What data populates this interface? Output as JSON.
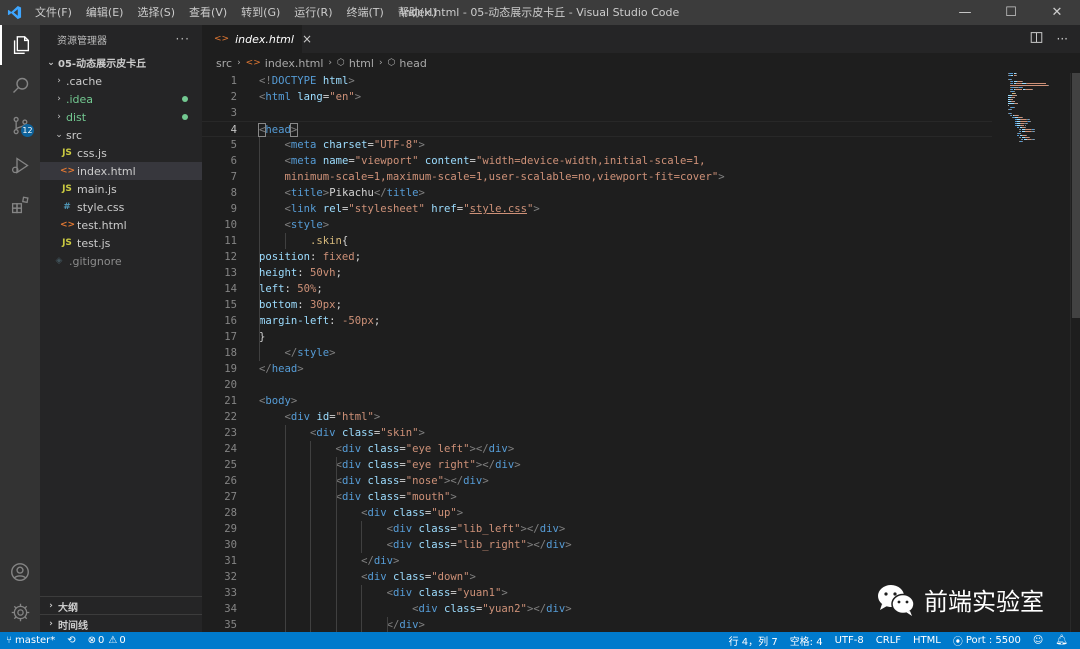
{
  "titlebar": {
    "menus": [
      "文件(F)",
      "编辑(E)",
      "选择(S)",
      "查看(V)",
      "转到(G)",
      "运行(R)",
      "终端(T)",
      "帮助(H)"
    ],
    "title": "index.html - 05-动态展示皮卡丘 - Visual Studio Code",
    "minimize": "—",
    "maximize": "☐",
    "close": "✕"
  },
  "activity": {
    "scm_badge": "12"
  },
  "explorer": {
    "header": "资源管理器",
    "more": "···",
    "root": "05-动态展示皮卡丘",
    "items": [
      {
        "label": ".cache",
        "kind": "folder",
        "indent": 1
      },
      {
        "label": ".idea",
        "kind": "folder",
        "indent": 1,
        "dot": true,
        "color": "#73c991"
      },
      {
        "label": "dist",
        "kind": "folder",
        "indent": 1,
        "dot": true,
        "color": "#73c991"
      },
      {
        "label": "src",
        "kind": "folder-open",
        "indent": 1
      },
      {
        "label": "css.js",
        "kind": "js",
        "indent": 2
      },
      {
        "label": "index.html",
        "kind": "html",
        "indent": 2,
        "selected": true
      },
      {
        "label": "main.js",
        "kind": "js",
        "indent": 2
      },
      {
        "label": "style.css",
        "kind": "css",
        "indent": 2
      },
      {
        "label": "test.html",
        "kind": "html",
        "indent": 2
      },
      {
        "label": "test.js",
        "kind": "js",
        "indent": 2
      },
      {
        "label": ".gitignore",
        "kind": "git",
        "indent": 1
      }
    ],
    "outline": "大纲",
    "timeline": "时间线"
  },
  "tab": {
    "label": "index.html",
    "close": "×"
  },
  "breadcrumb": {
    "src": "src",
    "file": "index.html",
    "html": "html",
    "head": "head"
  },
  "code": [
    [
      [
        "p",
        "<!"
      ],
      [
        "t",
        "DOCTYPE"
      ],
      [
        "d",
        " "
      ],
      [
        "a",
        "html"
      ],
      [
        "p",
        ">"
      ]
    ],
    [
      [
        "p",
        "<"
      ],
      [
        "t",
        "html"
      ],
      [
        "d",
        " "
      ],
      [
        "a",
        "lang"
      ],
      [
        "d",
        "="
      ],
      [
        "s",
        "\"en\""
      ],
      [
        "p",
        ">"
      ]
    ],
    [],
    [
      [
        "bm",
        "<"
      ],
      [
        "t",
        "head"
      ],
      [
        "bm",
        ">"
      ]
    ],
    [
      [
        "d",
        "    "
      ],
      [
        "p",
        "<"
      ],
      [
        "t",
        "meta"
      ],
      [
        "d",
        " "
      ],
      [
        "a",
        "charset"
      ],
      [
        "d",
        "="
      ],
      [
        "s",
        "\"UTF-8\""
      ],
      [
        "p",
        ">"
      ]
    ],
    [
      [
        "d",
        "    "
      ],
      [
        "p",
        "<"
      ],
      [
        "t",
        "meta"
      ],
      [
        "d",
        " "
      ],
      [
        "a",
        "name"
      ],
      [
        "d",
        "="
      ],
      [
        "s",
        "\"viewport\""
      ],
      [
        "d",
        " "
      ],
      [
        "a",
        "content"
      ],
      [
        "d",
        "="
      ],
      [
        "s",
        "\"width=device-width,initial-scale=1,"
      ]
    ],
    [
      [
        "s",
        "    minimum-scale=1,maximum-scale=1,user-scalable=no,viewport-fit=cover\""
      ],
      [
        "p",
        ">"
      ]
    ],
    [
      [
        "d",
        "    "
      ],
      [
        "p",
        "<"
      ],
      [
        "t",
        "title"
      ],
      [
        "p",
        ">"
      ],
      [
        "d",
        "Pikachu"
      ],
      [
        "p",
        "</"
      ],
      [
        "t",
        "title"
      ],
      [
        "p",
        ">"
      ]
    ],
    [
      [
        "d",
        "    "
      ],
      [
        "p",
        "<"
      ],
      [
        "t",
        "link"
      ],
      [
        "d",
        " "
      ],
      [
        "a",
        "rel"
      ],
      [
        "d",
        "="
      ],
      [
        "s",
        "\"stylesheet\""
      ],
      [
        "d",
        " "
      ],
      [
        "a",
        "href"
      ],
      [
        "d",
        "="
      ],
      [
        "s",
        "\""
      ],
      [
        "su",
        "style.css"
      ],
      [
        "s",
        "\""
      ],
      [
        "p",
        ">"
      ]
    ],
    [
      [
        "d",
        "    "
      ],
      [
        "p",
        "<"
      ],
      [
        "t",
        "style"
      ],
      [
        "p",
        ">"
      ]
    ],
    [
      [
        "d",
        "        "
      ],
      [
        "sel",
        ".skin"
      ],
      [
        "d",
        "{"
      ]
    ],
    [
      [
        "a",
        "position"
      ],
      [
        "d",
        ": "
      ],
      [
        "s",
        "fixed"
      ],
      [
        "d",
        ";"
      ]
    ],
    [
      [
        "a",
        "height"
      ],
      [
        "d",
        ": "
      ],
      [
        "s",
        "50vh"
      ],
      [
        "d",
        ";"
      ]
    ],
    [
      [
        "a",
        "left"
      ],
      [
        "d",
        ": "
      ],
      [
        "s",
        "50%"
      ],
      [
        "d",
        ";"
      ]
    ],
    [
      [
        "a",
        "bottom"
      ],
      [
        "d",
        ": "
      ],
      [
        "s",
        "30px"
      ],
      [
        "d",
        ";"
      ]
    ],
    [
      [
        "a",
        "margin-left"
      ],
      [
        "d",
        ": "
      ],
      [
        "s",
        "-50px"
      ],
      [
        "d",
        ";"
      ]
    ],
    [
      [
        "d",
        "}"
      ]
    ],
    [
      [
        "d",
        "    "
      ],
      [
        "p",
        "</"
      ],
      [
        "t",
        "style"
      ],
      [
        "p",
        ">"
      ]
    ],
    [
      [
        "p",
        "</"
      ],
      [
        "t",
        "head"
      ],
      [
        "p",
        ">"
      ]
    ],
    [],
    [
      [
        "p",
        "<"
      ],
      [
        "t",
        "body"
      ],
      [
        "p",
        ">"
      ]
    ],
    [
      [
        "d",
        "    "
      ],
      [
        "p",
        "<"
      ],
      [
        "t",
        "div"
      ],
      [
        "d",
        " "
      ],
      [
        "a",
        "id"
      ],
      [
        "d",
        "="
      ],
      [
        "s",
        "\"html\""
      ],
      [
        "p",
        ">"
      ]
    ],
    [
      [
        "d",
        "        "
      ],
      [
        "p",
        "<"
      ],
      [
        "t",
        "div"
      ],
      [
        "d",
        " "
      ],
      [
        "a",
        "class"
      ],
      [
        "d",
        "="
      ],
      [
        "s",
        "\"skin\""
      ],
      [
        "p",
        ">"
      ]
    ],
    [
      [
        "d",
        "            "
      ],
      [
        "p",
        "<"
      ],
      [
        "t",
        "div"
      ],
      [
        "d",
        " "
      ],
      [
        "a",
        "class"
      ],
      [
        "d",
        "="
      ],
      [
        "s",
        "\"eye left\""
      ],
      [
        "p",
        "></"
      ],
      [
        "t",
        "div"
      ],
      [
        "p",
        ">"
      ]
    ],
    [
      [
        "d",
        "            "
      ],
      [
        "p",
        "<"
      ],
      [
        "t",
        "div"
      ],
      [
        "d",
        " "
      ],
      [
        "a",
        "class"
      ],
      [
        "d",
        "="
      ],
      [
        "s",
        "\"eye right\""
      ],
      [
        "p",
        "></"
      ],
      [
        "t",
        "div"
      ],
      [
        "p",
        ">"
      ]
    ],
    [
      [
        "d",
        "            "
      ],
      [
        "p",
        "<"
      ],
      [
        "t",
        "div"
      ],
      [
        "d",
        " "
      ],
      [
        "a",
        "class"
      ],
      [
        "d",
        "="
      ],
      [
        "s",
        "\"nose\""
      ],
      [
        "p",
        "></"
      ],
      [
        "t",
        "div"
      ],
      [
        "p",
        ">"
      ]
    ],
    [
      [
        "d",
        "            "
      ],
      [
        "p",
        "<"
      ],
      [
        "t",
        "div"
      ],
      [
        "d",
        " "
      ],
      [
        "a",
        "class"
      ],
      [
        "d",
        "="
      ],
      [
        "s",
        "\"mouth\""
      ],
      [
        "p",
        ">"
      ]
    ],
    [
      [
        "d",
        "                "
      ],
      [
        "p",
        "<"
      ],
      [
        "t",
        "div"
      ],
      [
        "d",
        " "
      ],
      [
        "a",
        "class"
      ],
      [
        "d",
        "="
      ],
      [
        "s",
        "\"up\""
      ],
      [
        "p",
        ">"
      ]
    ],
    [
      [
        "d",
        "                    "
      ],
      [
        "p",
        "<"
      ],
      [
        "t",
        "div"
      ],
      [
        "d",
        " "
      ],
      [
        "a",
        "class"
      ],
      [
        "d",
        "="
      ],
      [
        "s",
        "\"lib_left\""
      ],
      [
        "p",
        "></"
      ],
      [
        "t",
        "div"
      ],
      [
        "p",
        ">"
      ]
    ],
    [
      [
        "d",
        "                    "
      ],
      [
        "p",
        "<"
      ],
      [
        "t",
        "div"
      ],
      [
        "d",
        " "
      ],
      [
        "a",
        "class"
      ],
      [
        "d",
        "="
      ],
      [
        "s",
        "\"lib_right\""
      ],
      [
        "p",
        "></"
      ],
      [
        "t",
        "div"
      ],
      [
        "p",
        ">"
      ]
    ],
    [
      [
        "d",
        "                "
      ],
      [
        "p",
        "</"
      ],
      [
        "t",
        "div"
      ],
      [
        "p",
        ">"
      ]
    ],
    [
      [
        "d",
        "                "
      ],
      [
        "p",
        "<"
      ],
      [
        "t",
        "div"
      ],
      [
        "d",
        " "
      ],
      [
        "a",
        "class"
      ],
      [
        "d",
        "="
      ],
      [
        "s",
        "\"down\""
      ],
      [
        "p",
        ">"
      ]
    ],
    [
      [
        "d",
        "                    "
      ],
      [
        "p",
        "<"
      ],
      [
        "t",
        "div"
      ],
      [
        "d",
        " "
      ],
      [
        "a",
        "class"
      ],
      [
        "d",
        "="
      ],
      [
        "s",
        "\"yuan1\""
      ],
      [
        "p",
        ">"
      ]
    ],
    [
      [
        "d",
        "                        "
      ],
      [
        "p",
        "<"
      ],
      [
        "t",
        "div"
      ],
      [
        "d",
        " "
      ],
      [
        "a",
        "class"
      ],
      [
        "d",
        "="
      ],
      [
        "s",
        "\"yuan2\""
      ],
      [
        "p",
        "></"
      ],
      [
        "t",
        "div"
      ],
      [
        "p",
        ">"
      ]
    ],
    [
      [
        "d",
        "                    "
      ],
      [
        "p",
        "</"
      ],
      [
        "t",
        "div"
      ],
      [
        "p",
        ">"
      ]
    ]
  ],
  "current_line": 4,
  "watermark": "前端实验室",
  "status": {
    "branch": "master*",
    "errors": "0",
    "warnings": "0",
    "position": "行 4，列 7",
    "spaces": "空格: 4",
    "encoding": "UTF-8",
    "eol": "CRLF",
    "language": "HTML",
    "port": "Port : 5500"
  },
  "colors": {
    "accent": "#007acc",
    "editor_bg": "#1e1e1e",
    "sidebar_bg": "#252526",
    "activity_bg": "#333333",
    "titlebar_bg": "#3c3c3c"
  }
}
